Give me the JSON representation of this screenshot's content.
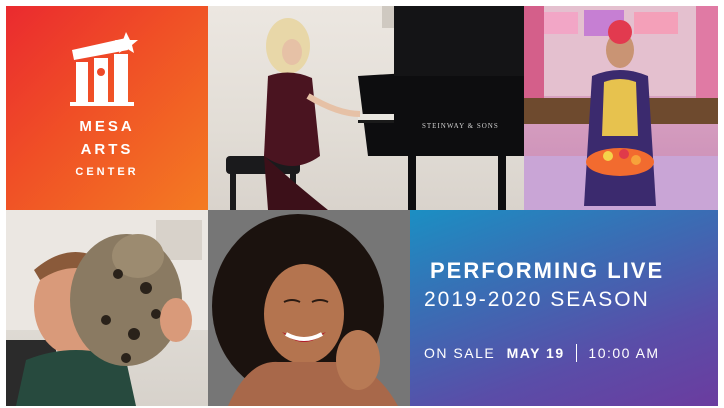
{
  "logo": {
    "word1": "MESA",
    "word2": "ARTS",
    "word3": "CENTER"
  },
  "piano": {
    "brand": "STEINWAY & SONS"
  },
  "promo": {
    "headline": "PERFORMING LIVE",
    "season": "2019-2020 SEASON",
    "on_sale_label": "ON SALE",
    "on_sale_date": "MAY 19",
    "on_sale_time": "10:00 AM"
  },
  "colors": {
    "logo_bg_start": "#ea2a2f",
    "logo_bg_end": "#f47b22",
    "promo_bg_start": "#1b8fc3",
    "promo_bg_end": "#6b3c9f"
  }
}
